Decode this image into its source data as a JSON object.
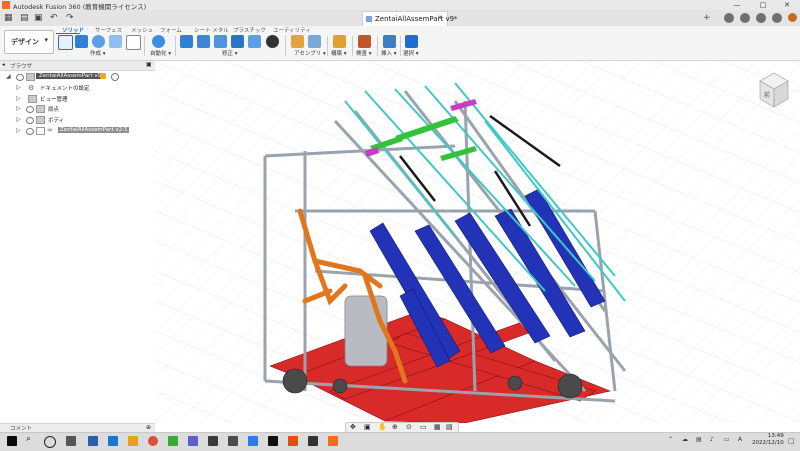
{
  "window": {
    "title": "Autodesk Fusion 360 (教育機関ライセンス)",
    "minimize": "—",
    "maximize": "□",
    "close": "✕"
  },
  "document_tab": {
    "name": "ZentaiAllAssemPart v9*",
    "close": "✕"
  },
  "ribbon": {
    "workspace": "デザイン",
    "tabs": [
      "ソリッド",
      "サーフェス",
      "メッシュ",
      "フォーム",
      "シート メタル",
      "プラスチック",
      "ユーティリティ"
    ],
    "groups": [
      "作成 ▾",
      "自動化 ▾",
      "修正 ▾",
      "アセンブリ ▾",
      "構築 ▾",
      "検査 ▾",
      "挿入 ▾",
      "選択 ▾"
    ]
  },
  "browser": {
    "title": "ブラウザ",
    "items": [
      {
        "label": "ZentaiAllAssemPart v9"
      },
      {
        "label": "ドキュメントの設定"
      },
      {
        "label": "ビュー管理"
      },
      {
        "label": "原点"
      },
      {
        "label": "ボディ"
      },
      {
        "label": "ZentaiAllAssemPart v2:1"
      }
    ]
  },
  "viewcube": {
    "face": "前"
  },
  "comments": {
    "label": "コメント"
  },
  "clock": {
    "time": "13:49",
    "date": "2022/12/10"
  },
  "colors": {
    "accent": "#1a6fcf",
    "frame": "#9aa3ad",
    "blue_panel": "#2233b8",
    "cyan_rail": "#3fc9c4",
    "orange_part": "#e0761d",
    "red_base": "#d92a2a",
    "green_part": "#35c23b",
    "magenta_part": "#c83bc7"
  }
}
